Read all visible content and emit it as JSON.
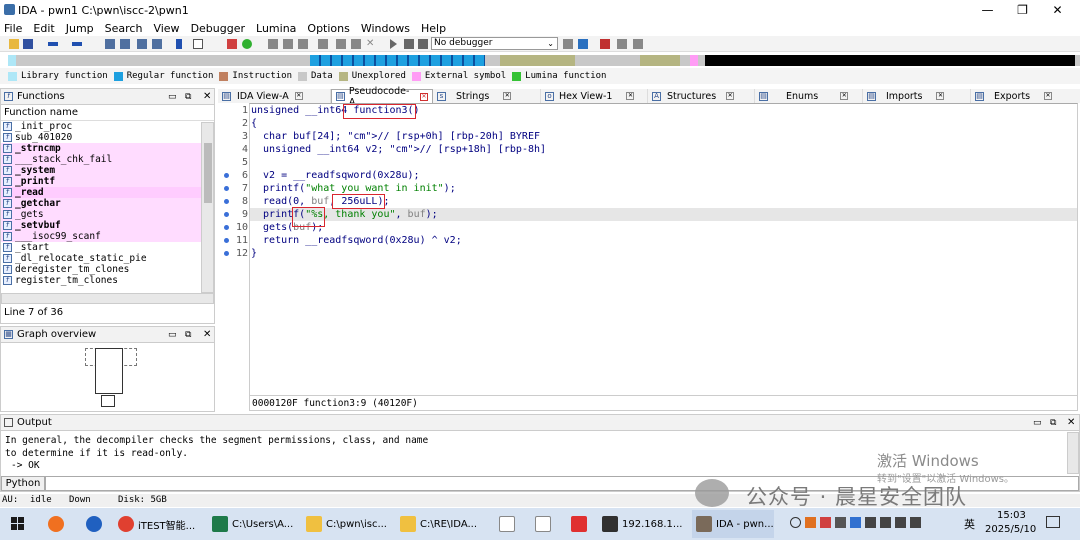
{
  "window": {
    "title": "IDA - pwn1 C:\\pwn\\iscc-2\\pwn1",
    "min": "—",
    "max": "❐",
    "close": "✕"
  },
  "menu": [
    "File",
    "Edit",
    "Jump",
    "Search",
    "View",
    "Debugger",
    "Lumina",
    "Options",
    "Windows",
    "Help"
  ],
  "toolbar": {
    "debugger_select": "No debugger"
  },
  "legend": [
    {
      "label": "Library function",
      "color": "#aee7f7"
    },
    {
      "label": "Regular function",
      "color": "#1da0e0"
    },
    {
      "label": "Instruction",
      "color": "#c08060"
    },
    {
      "label": "Data",
      "color": "#c8c8c8"
    },
    {
      "label": "Unexplored",
      "color": "#b5b582"
    },
    {
      "label": "External symbol",
      "color": "#ff9cf5"
    },
    {
      "label": "Lumina function",
      "color": "#35c235"
    }
  ],
  "functions": {
    "title": "Functions",
    "column": "Function name",
    "items": [
      {
        "name": "_init_proc",
        "bold": false,
        "pink": false
      },
      {
        "name": "sub_401020",
        "bold": false,
        "pink": false
      },
      {
        "name": "_strncmp",
        "bold": true,
        "pink": true
      },
      {
        "name": "___stack_chk_fail",
        "bold": false,
        "pink": true
      },
      {
        "name": "_system",
        "bold": true,
        "pink": true
      },
      {
        "name": "_printf",
        "bold": true,
        "pink": true
      },
      {
        "name": "_read",
        "bold": true,
        "pink": true
      },
      {
        "name": "_getchar",
        "bold": true,
        "pink": true
      },
      {
        "name": "_gets",
        "bold": false,
        "pink": true
      },
      {
        "name": "_setvbuf",
        "bold": true,
        "pink": true
      },
      {
        "name": "___isoc99_scanf",
        "bold": false,
        "pink": true
      },
      {
        "name": "_start",
        "bold": false,
        "pink": false
      },
      {
        "name": "_dl_relocate_static_pie",
        "bold": false,
        "pink": false
      },
      {
        "name": "deregister_tm_clones",
        "bold": false,
        "pink": false
      },
      {
        "name": "register_tm_clones",
        "bold": false,
        "pink": false
      }
    ],
    "status": "Line 7 of 36"
  },
  "graph_overview": {
    "title": "Graph overview"
  },
  "tabs": [
    {
      "label": "IDA View-A",
      "active": false
    },
    {
      "label": "Pseudocode-A",
      "active": true
    },
    {
      "label": "Strings",
      "active": false
    },
    {
      "label": "Hex View-1",
      "active": false
    },
    {
      "label": "Structures",
      "active": false
    },
    {
      "label": "Enums",
      "active": false
    },
    {
      "label": "Imports",
      "active": false
    },
    {
      "label": "Exports",
      "active": false
    }
  ],
  "code": {
    "lines": [
      {
        "n": "1",
        "dot": false,
        "text": "unsigned __int64 function3()"
      },
      {
        "n": "2",
        "dot": false,
        "text": "{"
      },
      {
        "n": "3",
        "dot": false,
        "text": "  char buf[24]; // [rsp+0h] [rbp-20h] BYREF"
      },
      {
        "n": "4",
        "dot": false,
        "text": "  unsigned __int64 v2; // [rsp+18h] [rbp-8h]"
      },
      {
        "n": "5",
        "dot": false,
        "text": ""
      },
      {
        "n": "6",
        "dot": true,
        "text": "  v2 = __readfsqword(0x28u);"
      },
      {
        "n": "7",
        "dot": true,
        "text": "  printf(\"what you want in init\");"
      },
      {
        "n": "8",
        "dot": true,
        "text": "  read(0, buf, 256uLL);"
      },
      {
        "n": "9",
        "dot": true,
        "text": "  printf(\"%s, thank you\", buf);"
      },
      {
        "n": "10",
        "dot": true,
        "text": "  gets(buf);"
      },
      {
        "n": "11",
        "dot": true,
        "text": "  return __readfsqword(0x28u) ^ v2;"
      },
      {
        "n": "12",
        "dot": true,
        "text": "}"
      }
    ],
    "status": "0000120F function3:9 (40120F)"
  },
  "output": {
    "title": "Output",
    "lines": [
      "In general, the decompiler checks the segment permissions, class, and name",
      "to determine if it is read-only.",
      "-> OK"
    ],
    "input_label": "Python"
  },
  "statusbar": {
    "au": "AU:",
    "state": "idle",
    "dir": "Down",
    "disk": "Disk: 5GB"
  },
  "watermark": {
    "activate": "激活 Windows",
    "sub": "转到\"设置\"以激活 Windows。",
    "account": "公众号 · 晨星安全团队"
  },
  "taskbar": {
    "items": [
      {
        "label": "iTEST智能...",
        "color": "#e04030"
      },
      {
        "label": "C:\\Users\\A...",
        "color": "#1e7a4a"
      },
      {
        "label": "C:\\pwn\\isc...",
        "color": "#f0c040"
      },
      {
        "label": "C:\\RE\\IDA...",
        "color": "#f0c040"
      },
      {
        "label": "",
        "color": "#ffffff"
      },
      {
        "label": "",
        "color": "#ffffff"
      },
      {
        "label": "",
        "color": "#e03030"
      },
      {
        "label": "192.168.1...",
        "color": "#303030"
      },
      {
        "label": "IDA - pwn...",
        "color": "#7a6a5a"
      }
    ],
    "ime": "英",
    "time": "15:03",
    "date": "2025/5/10"
  }
}
